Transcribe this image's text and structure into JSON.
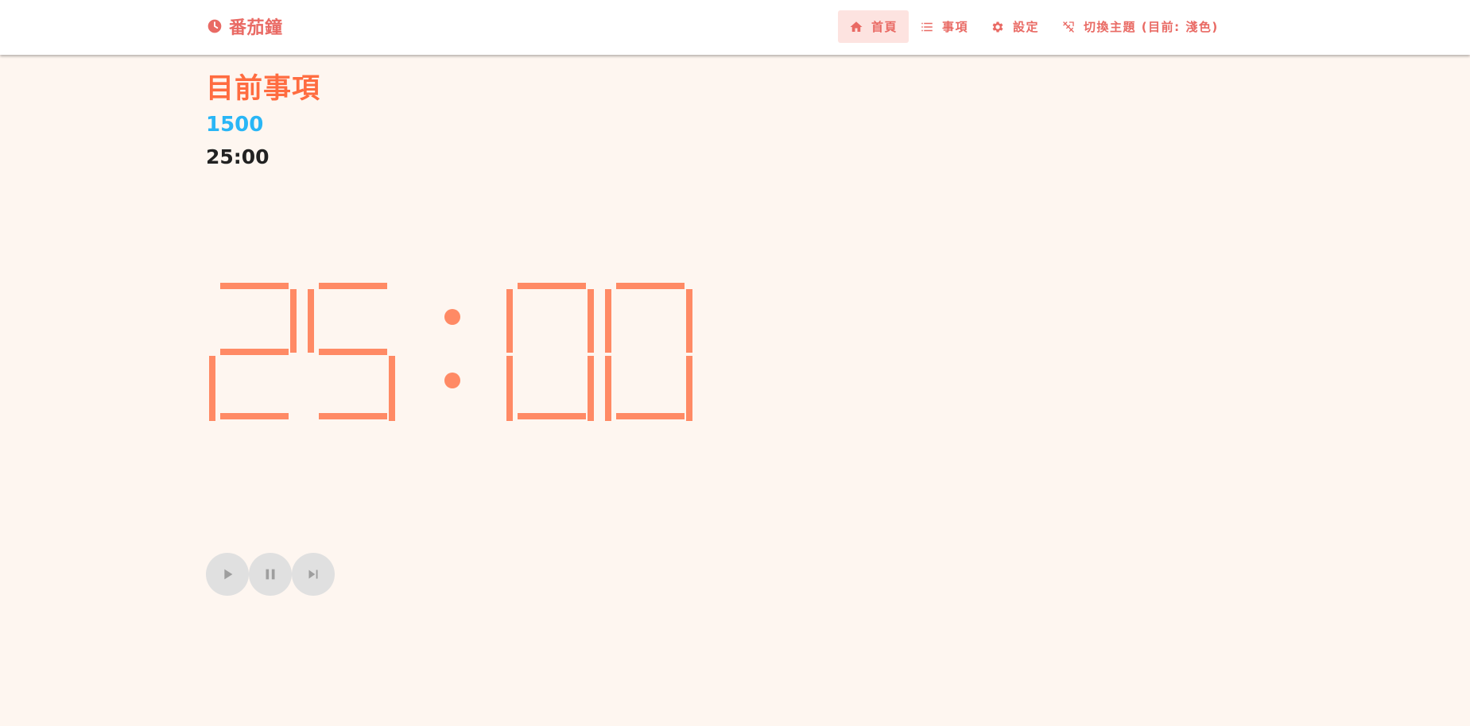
{
  "app": {
    "title": "番茄鐘",
    "brand_color": "#e96a64",
    "icon": "clock-icon"
  },
  "nav": {
    "items": [
      {
        "label": "首頁",
        "icon": "home-icon",
        "active": true
      },
      {
        "label": "事項",
        "icon": "list-icon",
        "active": false
      },
      {
        "label": "設定",
        "icon": "gear-icon",
        "active": false
      },
      {
        "label": "切換主題 (目前: 淺色)",
        "icon": "theme-toggle-icon",
        "active": false
      }
    ]
  },
  "main": {
    "heading": "目前事項",
    "count": "1500",
    "time_small": "25:00",
    "clock_display": "25:00",
    "accent_color": "#ff6c40",
    "count_color": "#29b6f6",
    "clock_color": "#ff8a65"
  },
  "controls": [
    {
      "icon": "play-icon",
      "action": "play"
    },
    {
      "icon": "pause-icon",
      "action": "pause"
    },
    {
      "icon": "skip-next-icon",
      "action": "skip"
    }
  ]
}
